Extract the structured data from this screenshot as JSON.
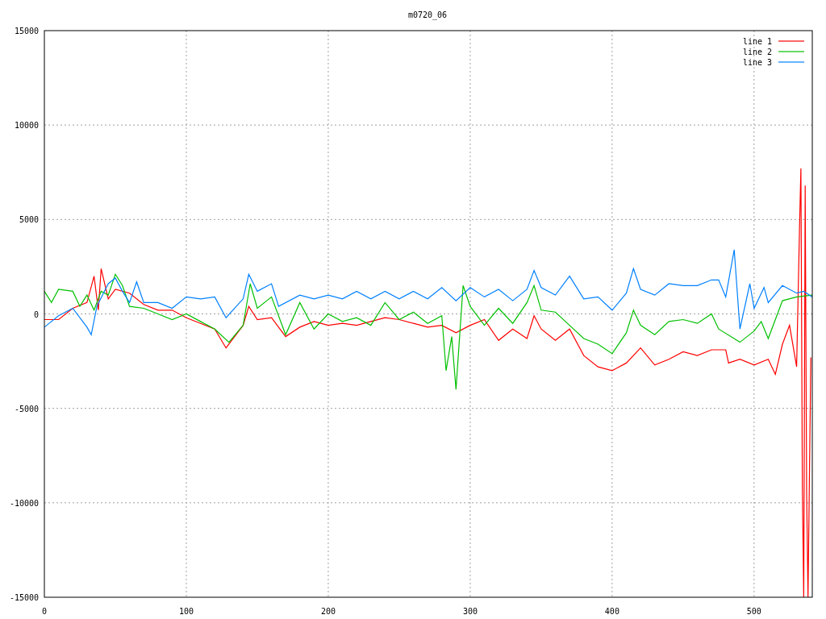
{
  "chart_data": {
    "type": "line",
    "title": "m0720_06",
    "grid": true,
    "legend": true,
    "xlim": [
      0,
      541
    ],
    "ylim": [
      -15000,
      15000
    ],
    "xticks": [
      0,
      100,
      200,
      300,
      400,
      500
    ],
    "yticks": [
      -15000,
      -10000,
      -5000,
      0,
      5000,
      10000,
      15000
    ],
    "series": [
      {
        "name": "line 1",
        "color": "#ff0000",
        "x": [
          0,
          10,
          20,
          30,
          35,
          38,
          40,
          45,
          50,
          60,
          70,
          80,
          90,
          100,
          110,
          120,
          128,
          140,
          144,
          150,
          160,
          170,
          180,
          190,
          200,
          210,
          220,
          230,
          240,
          250,
          260,
          270,
          280,
          290,
          300,
          310,
          320,
          330,
          340,
          345,
          350,
          360,
          370,
          380,
          390,
          400,
          410,
          420,
          430,
          440,
          450,
          460,
          470,
          480,
          482,
          490,
          500,
          510,
          515,
          520,
          525,
          530,
          532,
          533,
          534,
          535,
          536,
          537,
          538,
          540
        ],
        "values": [
          -300,
          -300,
          300,
          600,
          2000,
          200,
          2400,
          800,
          1300,
          1100,
          500,
          200,
          200,
          -200,
          -500,
          -800,
          -1800,
          -600,
          400,
          -300,
          -200,
          -1200,
          -700,
          -400,
          -600,
          -500,
          -600,
          -400,
          -200,
          -300,
          -500,
          -700,
          -600,
          -1000,
          -600,
          -300,
          -1400,
          -800,
          -1300,
          -100,
          -800,
          -1400,
          -800,
          -2200,
          -2800,
          -3000,
          -2600,
          -1800,
          -2700,
          -2400,
          -2000,
          -2200,
          -1900,
          -1900,
          -2600,
          -2400,
          -2700,
          -2400,
          -3200,
          -1600,
          -600,
          -2800,
          4600,
          7700,
          -9200,
          -15000,
          6800,
          -9500,
          -15000,
          -2300
        ]
      },
      {
        "name": "line 2",
        "color": "#00c000",
        "x": [
          0,
          5,
          10,
          20,
          25,
          30,
          35,
          40,
          45,
          50,
          55,
          60,
          70,
          80,
          90,
          100,
          110,
          120,
          130,
          140,
          145,
          150,
          160,
          170,
          180,
          190,
          200,
          210,
          220,
          230,
          240,
          250,
          260,
          270,
          280,
          283,
          287,
          290,
          295,
          300,
          310,
          320,
          330,
          340,
          345,
          350,
          360,
          370,
          380,
          390,
          400,
          410,
          415,
          420,
          430,
          440,
          450,
          460,
          470,
          475,
          490,
          500,
          505,
          510,
          520,
          530,
          541
        ],
        "values": [
          1200,
          600,
          1300,
          1200,
          400,
          1000,
          200,
          1200,
          1000,
          2100,
          1500,
          400,
          300,
          0,
          -300,
          0,
          -400,
          -800,
          -1500,
          -600,
          1600,
          300,
          900,
          -1100,
          600,
          -800,
          0,
          -400,
          -200,
          -600,
          600,
          -300,
          100,
          -500,
          -100,
          -3000,
          -1200,
          -4000,
          1500,
          400,
          -600,
          300,
          -500,
          600,
          1500,
          200,
          100,
          -600,
          -1300,
          -1600,
          -2100,
          -1000,
          200,
          -600,
          -1100,
          -400,
          -300,
          -500,
          0,
          -800,
          -1500,
          -900,
          -400,
          -1300,
          700,
          900,
          1000
        ]
      },
      {
        "name": "line 3",
        "color": "#0080ff",
        "x": [
          0,
          10,
          20,
          30,
          33,
          37,
          45,
          50,
          55,
          60,
          65,
          70,
          80,
          90,
          100,
          110,
          120,
          128,
          140,
          144,
          150,
          160,
          165,
          180,
          190,
          200,
          210,
          220,
          230,
          240,
          250,
          260,
          270,
          280,
          290,
          300,
          310,
          320,
          330,
          340,
          345,
          350,
          360,
          370,
          380,
          390,
          400,
          410,
          415,
          420,
          430,
          440,
          450,
          460,
          470,
          475,
          480,
          486,
          490,
          497,
          500,
          507,
          510,
          520,
          530,
          535,
          541
        ],
        "values": [
          -700,
          -100,
          300,
          -700,
          -1100,
          400,
          1600,
          1900,
          1200,
          600,
          1700,
          600,
          600,
          300,
          900,
          800,
          900,
          -200,
          800,
          2100,
          1200,
          1600,
          400,
          1000,
          800,
          1000,
          800,
          1200,
          800,
          1200,
          800,
          1200,
          800,
          1400,
          700,
          1400,
          900,
          1300,
          700,
          1300,
          2300,
          1400,
          1000,
          2000,
          800,
          900,
          200,
          1100,
          2400,
          1300,
          1000,
          1600,
          1500,
          1500,
          1800,
          1800,
          900,
          3400,
          -800,
          1600,
          300,
          1400,
          600,
          1500,
          1100,
          1200,
          900
        ]
      }
    ]
  }
}
